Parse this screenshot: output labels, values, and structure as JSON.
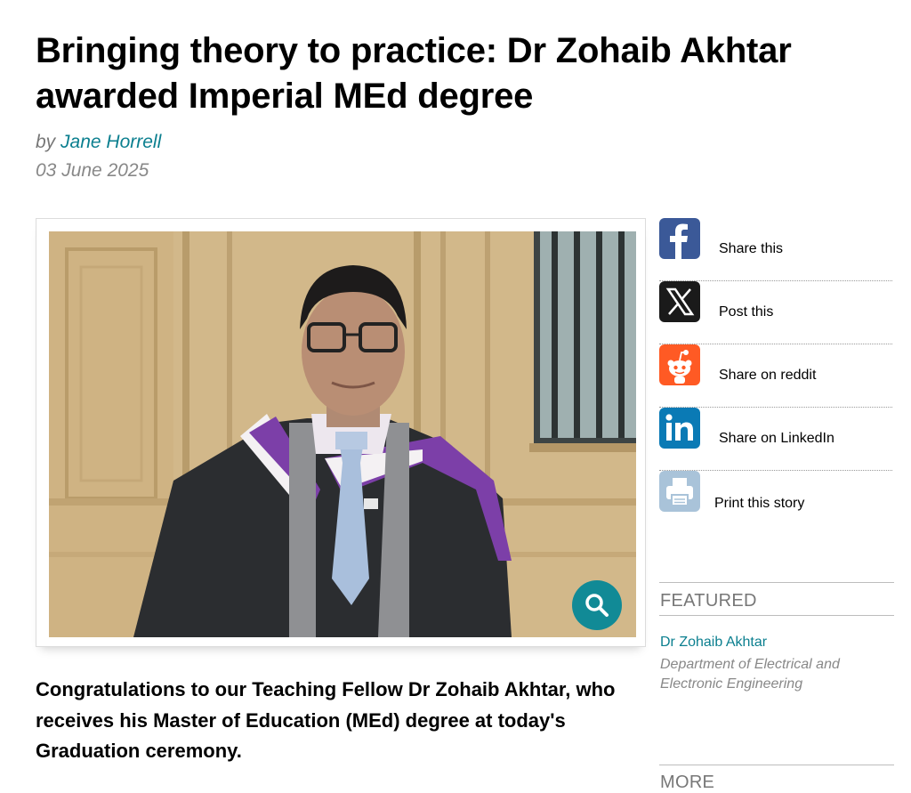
{
  "article": {
    "title": "Bringing theory to practice: Dr Zohaib Akhtar awarded Imperial MEd degree",
    "byline_prefix": "by",
    "author": "Jane Horrell",
    "date": "03 June 2025",
    "lead": "Congratulations to our Teaching Fellow Dr Zohaib Akhtar, who receives his Master of Education (MEd) degree at today's Graduation ceremony.",
    "image": {
      "icon": "zoom-magnifier-icon"
    }
  },
  "share": {
    "items": [
      {
        "label": "Share this",
        "icon": "facebook-icon",
        "color": "#3b5998"
      },
      {
        "label": "Post this",
        "icon": "x-icon",
        "color": "#1a1a1a"
      },
      {
        "label": "Share on reddit",
        "icon": "reddit-icon",
        "color": "#ff5a24"
      },
      {
        "label": "Share on LinkedIn",
        "icon": "linkedin-icon",
        "color": "#0a7ab5"
      },
      {
        "label": "Print this story",
        "icon": "printer-icon",
        "color": "#a9c3d9"
      }
    ]
  },
  "featured": {
    "heading": "FEATURED",
    "name": "Dr Zohaib Akhtar",
    "department": "Department of Electrical and Electronic Engineering"
  },
  "more": {
    "heading": "MORE"
  },
  "colors": {
    "link": "#0b7f8f",
    "accent": "#118a96"
  }
}
